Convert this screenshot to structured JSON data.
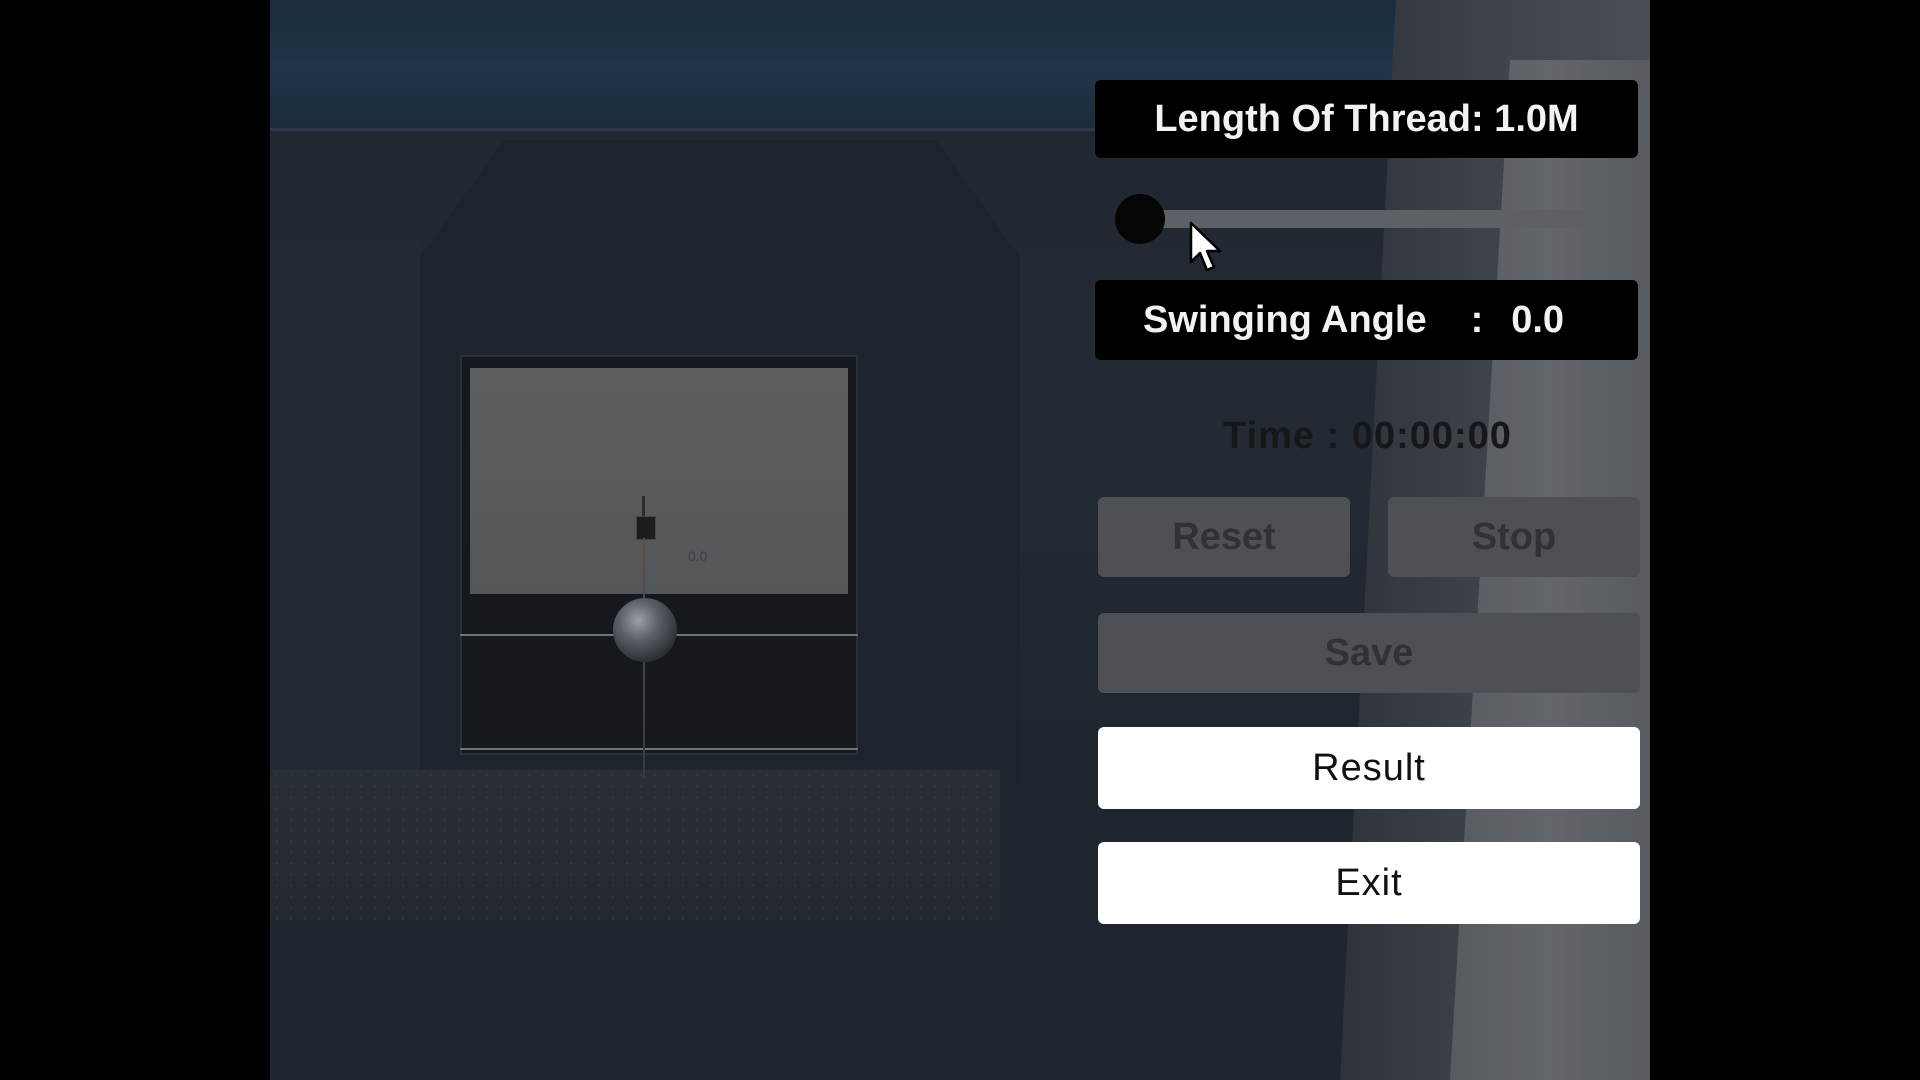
{
  "hud": {
    "thread_label": "Length Of Thread: 1.0M",
    "angle_label": "Swinging Angle",
    "angle_separator": ":",
    "angle_value": "0.0",
    "time_text": "Time : 00:00:00"
  },
  "slider": {
    "value": 0.0
  },
  "scene": {
    "pivot_readout": "0.0"
  },
  "buttons": {
    "reset": "Reset",
    "stop": "Stop",
    "save": "Save",
    "result": "Result",
    "exit": "Exit"
  },
  "colors": {
    "label_bg": "#000000",
    "label_text": "#f2f2f2",
    "disabled_button_bg": "#4d5156",
    "disabled_button_text": "#2f3236",
    "enabled_button_bg": "#ffffff",
    "enabled_button_text": "#111111",
    "slider_track": "#5d6166",
    "slider_handle": "#050505"
  },
  "icons": {
    "cursor": "arrow-cursor-icon"
  }
}
